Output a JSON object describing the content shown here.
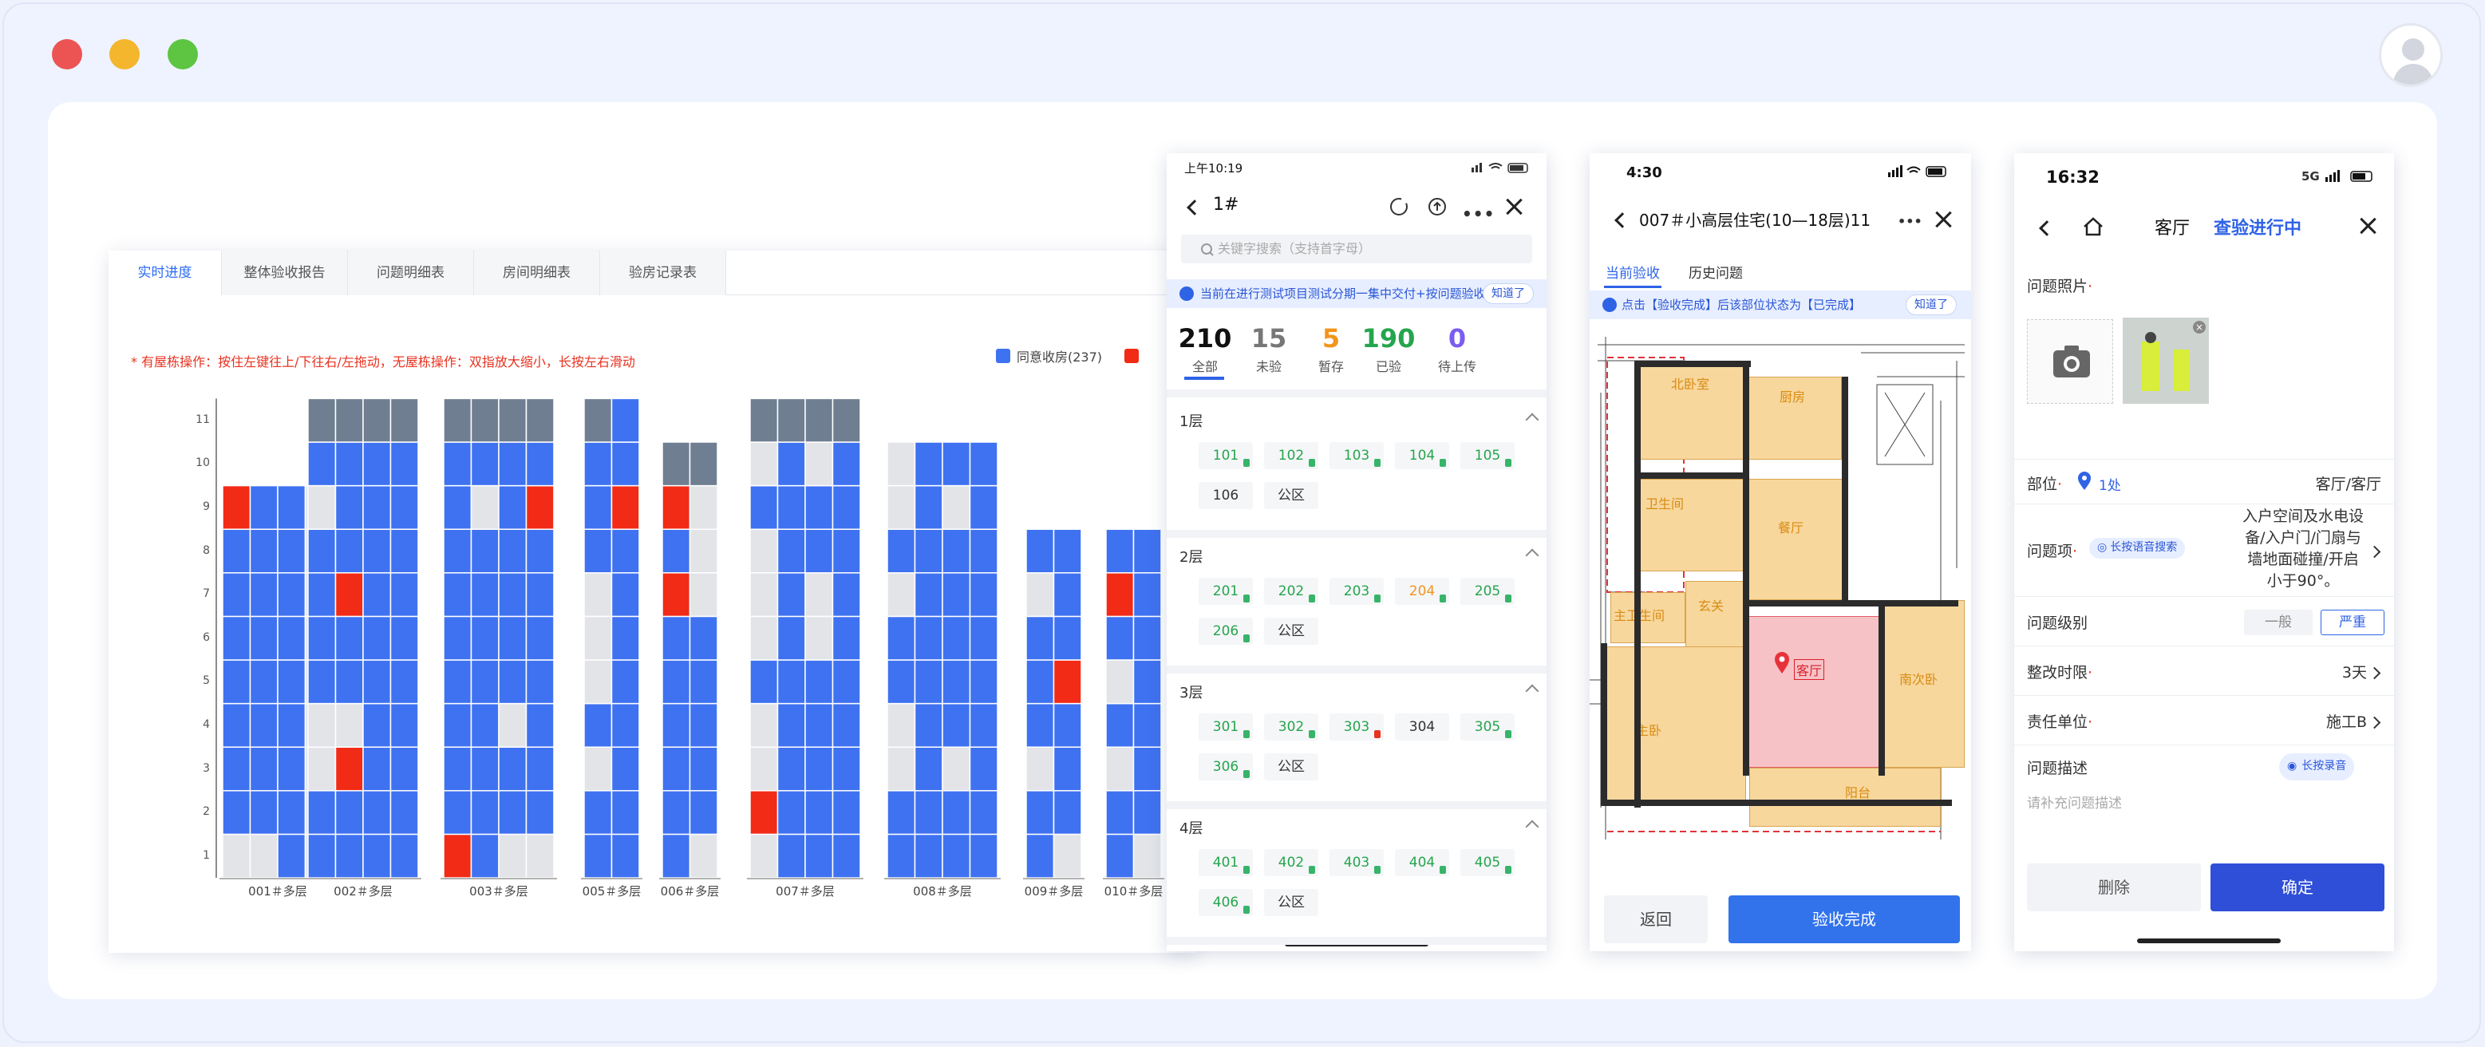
{
  "dashboard": {
    "tabs": [
      "实时进度",
      "整体验收报告",
      "问题明细表",
      "房间明细表",
      "验房记录表"
    ],
    "hint": "* 有屋栋操作：按住左键往上/下往右/左拖动，无屋栋操作：双指放大缩小，长按左右滑动",
    "legend": [
      {
        "label": "同意收房(237)",
        "color": "#3f72f1"
      },
      {
        "label": "",
        "color": "#f22b17"
      }
    ],
    "colors": {
      "agree": "#3f72f1",
      "empty": "#e2e4e8",
      "problem": "#f22b17",
      "public": "#6f7e91"
    }
  },
  "chart_data": {
    "type": "heatmap",
    "title": "",
    "xlabel": "",
    "ylabel": "",
    "y_ticks": [
      "1",
      "2",
      "3",
      "4",
      "5",
      "6",
      "7",
      "8",
      "9",
      "10",
      "11"
    ],
    "legend": [
      "同意收房(237)"
    ],
    "buildings": [
      {
        "name": "001＃多层",
        "floors": 9,
        "rows": [
          [
            "E",
            "E",
            "B",
            "E"
          ],
          [
            "B",
            "B",
            "B",
            "E"
          ],
          [
            "B",
            "B",
            "B",
            "E"
          ],
          [
            "B",
            "B",
            "B",
            "E"
          ],
          [
            "B",
            "B",
            "B",
            "E"
          ],
          [
            "B",
            "B",
            "B",
            "E"
          ],
          [
            "B",
            "B",
            "B",
            "E"
          ],
          [
            "B",
            "B",
            "B",
            "E"
          ],
          [
            "R",
            "B",
            "B",
            "E"
          ]
        ]
      },
      {
        "name": "002＃多层",
        "floors": 11,
        "rows": [
          [
            "B",
            "B",
            "B",
            "B"
          ],
          [
            "B",
            "B",
            "B",
            "B"
          ],
          [
            "E",
            "R",
            "B",
            "B"
          ],
          [
            "E",
            "E",
            "B",
            "B"
          ],
          [
            "B",
            "B",
            "B",
            "B"
          ],
          [
            "B",
            "B",
            "B",
            "B"
          ],
          [
            "B",
            "R",
            "B",
            "B"
          ],
          [
            "B",
            "B",
            "B",
            "B"
          ],
          [
            "E",
            "B",
            "B",
            "B"
          ],
          [
            "B",
            "B",
            "B",
            "B"
          ],
          [
            "P",
            "P",
            "P",
            "P"
          ]
        ]
      },
      {
        "name": "003＃多层",
        "floors": 11,
        "rows": [
          [
            "R",
            "B",
            "E",
            "E"
          ],
          [
            "B",
            "B",
            "B",
            "B"
          ],
          [
            "B",
            "B",
            "B",
            "B"
          ],
          [
            "B",
            "B",
            "E",
            "B"
          ],
          [
            "B",
            "B",
            "B",
            "B"
          ],
          [
            "B",
            "B",
            "B",
            "B"
          ],
          [
            "B",
            "B",
            "B",
            "B"
          ],
          [
            "B",
            "B",
            "B",
            "B"
          ],
          [
            "B",
            "E",
            "B",
            "R"
          ],
          [
            "B",
            "B",
            "B",
            "B"
          ],
          [
            "P",
            "P",
            "P",
            "P"
          ]
        ]
      },
      {
        "name": "005＃多层",
        "floors": 10,
        "rows": [
          [
            "B",
            "B"
          ],
          [
            "B",
            "B"
          ],
          [
            "E",
            "B"
          ],
          [
            "B",
            "B"
          ],
          [
            "E",
            "B"
          ],
          [
            "E",
            "B"
          ],
          [
            "E",
            "B"
          ],
          [
            "B",
            "B"
          ],
          [
            "B",
            "R"
          ],
          [
            "B",
            "B"
          ],
          [
            "P",
            "B"
          ]
        ]
      },
      {
        "name": "006＃多层",
        "floors": 10,
        "rows": [
          [
            "B",
            "E"
          ],
          [
            "B",
            "B"
          ],
          [
            "B",
            "B"
          ],
          [
            "B",
            "B"
          ],
          [
            "B",
            "B"
          ],
          [
            "B",
            "B"
          ],
          [
            "R",
            "E"
          ],
          [
            "B",
            "E"
          ],
          [
            "R",
            "E"
          ],
          [
            "P",
            "P"
          ]
        ]
      },
      {
        "name": "007＃多层",
        "floors": 11,
        "rows": [
          [
            "E",
            "B",
            "B",
            "B"
          ],
          [
            "R",
            "B",
            "B",
            "B"
          ],
          [
            "E",
            "B",
            "B",
            "B"
          ],
          [
            "E",
            "B",
            "B",
            "B"
          ],
          [
            "B",
            "B",
            "B",
            "B"
          ],
          [
            "E",
            "B",
            "E",
            "B"
          ],
          [
            "E",
            "B",
            "E",
            "B"
          ],
          [
            "E",
            "B",
            "B",
            "B"
          ],
          [
            "B",
            "B",
            "B",
            "B"
          ],
          [
            "E",
            "B",
            "E",
            "B"
          ],
          [
            "P",
            "P",
            "P",
            "P"
          ]
        ]
      },
      {
        "name": "008＃多层",
        "floors": 10,
        "rows": [
          [
            "B",
            "B",
            "B",
            "B"
          ],
          [
            "B",
            "B",
            "B",
            "B"
          ],
          [
            "E",
            "B",
            "E",
            "B"
          ],
          [
            "E",
            "B",
            "B",
            "B"
          ],
          [
            "B",
            "B",
            "B",
            "B"
          ],
          [
            "B",
            "B",
            "B",
            "B"
          ],
          [
            "E",
            "B",
            "B",
            "B"
          ],
          [
            "B",
            "B",
            "B",
            "B"
          ],
          [
            "E",
            "B",
            "E",
            "B"
          ],
          [
            "E",
            "B",
            "B",
            "B"
          ]
        ]
      },
      {
        "name": "009＃多层",
        "floors": 8,
        "rows": [
          [
            "B",
            "E"
          ],
          [
            "B",
            "B"
          ],
          [
            "E",
            "B"
          ],
          [
            "B",
            "B"
          ],
          [
            "B",
            "R"
          ],
          [
            "B",
            "B"
          ],
          [
            "E",
            "B"
          ],
          [
            "B",
            "B"
          ]
        ]
      },
      {
        "name": "010＃多层",
        "floors": 8,
        "rows": [
          [
            "B",
            "E"
          ],
          [
            "B",
            "B"
          ],
          [
            "E",
            "B"
          ],
          [
            "B",
            "B"
          ],
          [
            "E",
            "B"
          ],
          [
            "B",
            "B"
          ],
          [
            "R",
            "B"
          ],
          [
            "B",
            "B"
          ]
        ]
      }
    ]
  },
  "phone1": {
    "time": "上午10:19",
    "title": "1#",
    "search_placeholder": "关键字搜索（支持首字母）",
    "banner": "当前在进行测试项目测试分期一集中交付+按问题验收",
    "banner_btn": "知道了",
    "stats": [
      {
        "n": "210",
        "l": "全部",
        "c": "#111"
      },
      {
        "n": "15",
        "l": "未验",
        "c": "#777"
      },
      {
        "n": "5",
        "l": "暂存",
        "c": "#f2951b"
      },
      {
        "n": "190",
        "l": "已验",
        "c": "#25a54d"
      },
      {
        "n": "0",
        "l": "待上传",
        "c": "#7b5cf0"
      }
    ],
    "floors": [
      {
        "name": "1层",
        "rooms": [
          [
            "101",
            "g"
          ],
          [
            "102",
            "g"
          ],
          [
            "103",
            "g"
          ],
          [
            "104",
            "g"
          ],
          [
            "105",
            "g"
          ],
          [
            "106",
            ""
          ],
          [
            "公区",
            ""
          ]
        ]
      },
      {
        "name": "2层",
        "rooms": [
          [
            "201",
            "g"
          ],
          [
            "202",
            "g"
          ],
          [
            "203",
            "g"
          ],
          [
            "204",
            "o"
          ],
          [
            "205",
            "g"
          ],
          [
            "206",
            "g"
          ],
          [
            "公区",
            ""
          ]
        ]
      },
      {
        "name": "3层",
        "rooms": [
          [
            "301",
            "g"
          ],
          [
            "302",
            "g"
          ],
          [
            "303",
            "r"
          ],
          [
            "304",
            ""
          ],
          [
            "305",
            "g"
          ],
          [
            "306",
            "g"
          ],
          [
            "公区",
            ""
          ]
        ]
      },
      {
        "name": "4层",
        "rooms": [
          [
            "401",
            "g"
          ],
          [
            "402",
            "g"
          ],
          [
            "403",
            "g"
          ],
          [
            "404",
            "g"
          ],
          [
            "405",
            "g"
          ],
          [
            "406",
            "g"
          ],
          [
            "公区",
            ""
          ]
        ]
      }
    ]
  },
  "phone2": {
    "time": "4:30",
    "title": "007＃小高层住宅(10—18层)11",
    "tabs": [
      "当前验收",
      "历史问题"
    ],
    "banner": "点击【验收完成】后该部位状态为【已完成】",
    "banner_btn": "知道了",
    "rooms": [
      "北卧室",
      "厨房",
      "卫生间",
      "餐厅",
      "主卫生间",
      "玄关",
      "客厅",
      "主卧",
      "南次卧",
      "阳台"
    ],
    "btn_back": "返回",
    "btn_done": "验收完成"
  },
  "phone3": {
    "time": "16:32",
    "net": "5G",
    "title": "客厅",
    "status": "查验进行中",
    "photo_label": "问题照片",
    "location_label": "部位",
    "location_count": "1处",
    "location_value": "客厅/客厅",
    "issue_label": "问题项",
    "voice_search": "长按语音搜索",
    "issue_value": "入户空间及水电设备/入户门/门扇与墙地面碰撞/开启小于90°。",
    "level_label": "问题级别",
    "level_options": [
      "一般",
      "严重"
    ],
    "deadline_label": "整改时限",
    "deadline_value": "3天",
    "unit_label": "责任单位",
    "unit_value": "施工B",
    "desc_label": "问题描述",
    "voice_record": "长按录音",
    "desc_placeholder": "请补充问题描述",
    "btn_delete": "删除",
    "btn_ok": "确定"
  }
}
